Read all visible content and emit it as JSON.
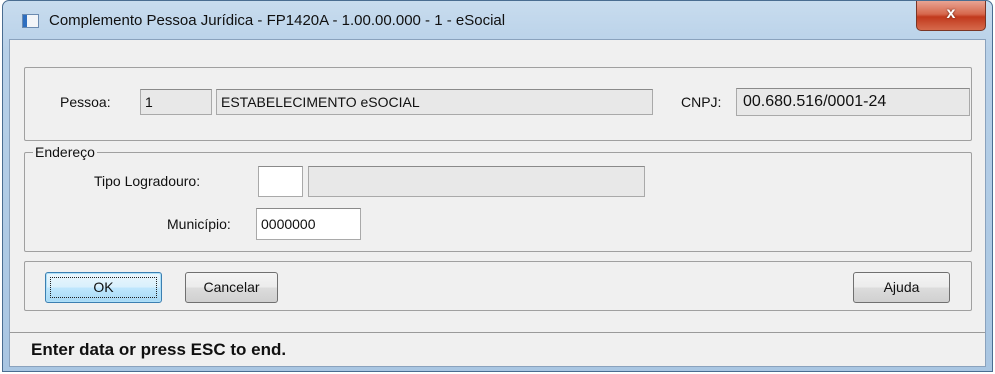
{
  "window": {
    "title": "Complemento Pessoa Jurídica - FP1420A - 1.00.00.000 - 1 - eSocial",
    "close_glyph": "x"
  },
  "pessoa": {
    "label": "Pessoa:",
    "id": "1",
    "name": "ESTABELECIMENTO eSOCIAL"
  },
  "cnpj": {
    "label": "CNPJ:",
    "value": "00.680.516/0001-24"
  },
  "endereco": {
    "legend": "Endereço",
    "tipo_logradouro_label": "Tipo Logradouro:",
    "tipo_logradouro_code": "",
    "tipo_logradouro_desc": "",
    "municipio_label": "Município:",
    "municipio_value": "0000000"
  },
  "buttons": {
    "ok": "OK",
    "cancelar": "Cancelar",
    "ajuda": "Ajuda"
  },
  "status": {
    "text": "Enter data or press ESC to end."
  }
}
